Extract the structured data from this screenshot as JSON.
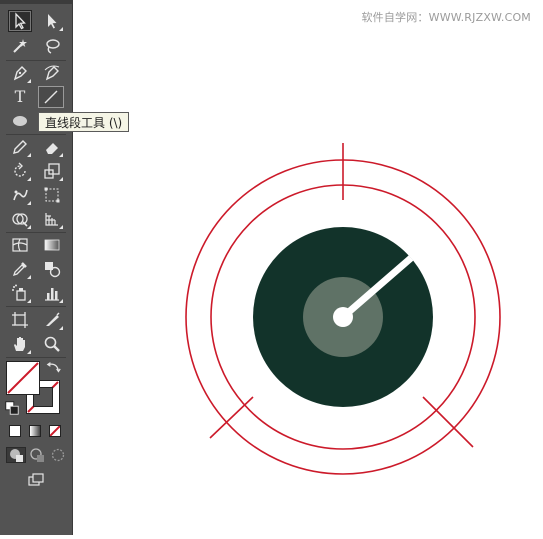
{
  "watermark": "软件自学网：WWW.RJZXW.COM",
  "tooltip": "直线段工具 (\\)",
  "tools": [
    {
      "name": "selection-tool",
      "icon": "arrow-icon"
    },
    {
      "name": "direct-selection-tool",
      "icon": "white-arrow-icon"
    },
    {
      "name": "magic-wand-tool",
      "icon": "magic-wand-icon"
    },
    {
      "name": "lasso-tool",
      "icon": "lasso-icon"
    },
    {
      "name": "pen-tool",
      "icon": "pen-icon"
    },
    {
      "name": "curvature-tool",
      "icon": "curvature-pen-icon"
    },
    {
      "name": "type-tool",
      "icon": "type-icon",
      "glyph": "T"
    },
    {
      "name": "line-segment-tool",
      "icon": "line-icon"
    },
    {
      "name": "ellipse-tool",
      "icon": "ellipse-icon"
    },
    {
      "name": "pencil-tool",
      "icon": "pencil-icon"
    },
    {
      "name": "eraser-tool",
      "icon": "eraser-icon"
    },
    {
      "name": "rotate-tool",
      "icon": "rotate-icon"
    },
    {
      "name": "scale-tool",
      "icon": "scale-icon"
    },
    {
      "name": "puppet-warp-tool",
      "icon": "puppet-icon"
    },
    {
      "name": "free-transform-tool",
      "icon": "free-transform-icon"
    },
    {
      "name": "shape-builder-tool",
      "icon": "shape-builder-icon"
    },
    {
      "name": "perspective-grid-tool",
      "icon": "perspective-grid-icon"
    },
    {
      "name": "mesh-tool",
      "icon": "mesh-icon"
    },
    {
      "name": "gradient-tool",
      "icon": "gradient-icon"
    },
    {
      "name": "eyedropper-tool",
      "icon": "eyedropper-icon"
    },
    {
      "name": "blend-tool",
      "icon": "blend-icon"
    },
    {
      "name": "symbol-sprayer-tool",
      "icon": "symbol-sprayer-icon"
    },
    {
      "name": "column-graph-tool",
      "icon": "column-graph-icon"
    },
    {
      "name": "artboard-tool",
      "icon": "artboard-icon"
    },
    {
      "name": "slice-tool",
      "icon": "slice-icon"
    },
    {
      "name": "hand-tool",
      "icon": "hand-icon"
    },
    {
      "name": "zoom-tool",
      "icon": "zoom-icon"
    }
  ],
  "colors": {
    "toolbar_bg": "#535353",
    "record_dark": "#12332a",
    "record_label": "#5f7266",
    "needle": "#ffffff",
    "guide_red": "#cc1a2a"
  }
}
